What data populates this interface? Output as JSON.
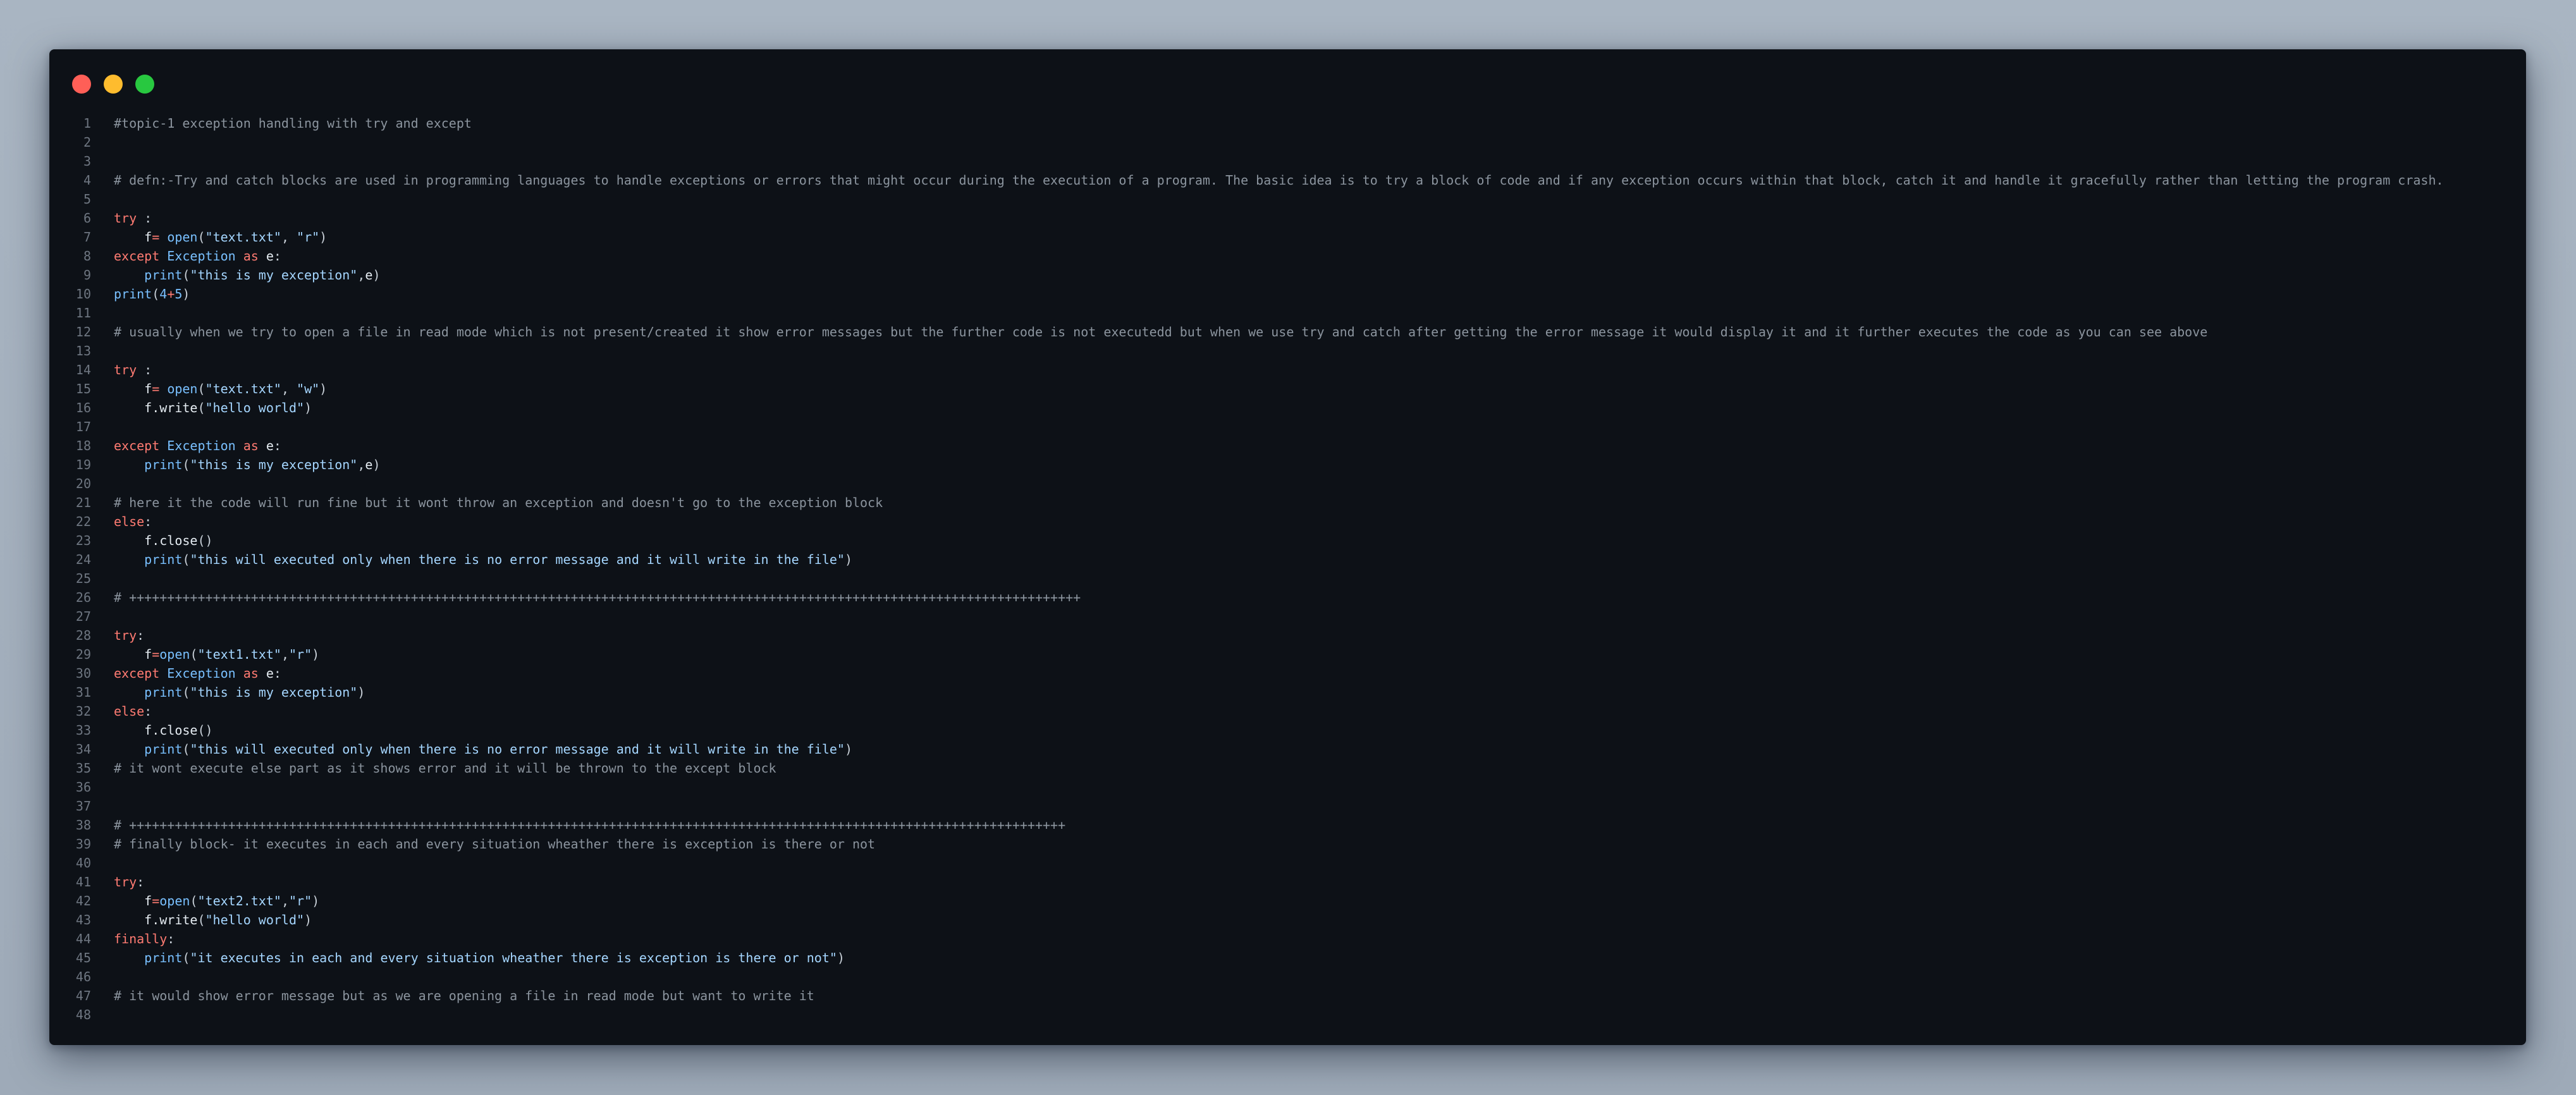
{
  "window": {
    "controls": [
      "close",
      "minimize",
      "maximize"
    ]
  },
  "colors": {
    "background": "#0d1117",
    "line_number": "#6e7681",
    "comment": "#8b949e",
    "keyword": "#ff7b72",
    "function": "#79c0ff",
    "string": "#a5d6ff",
    "text": "#c9d1d9"
  },
  "lines": [
    {
      "n": "1",
      "tokens": [
        [
          "comment",
          "#topic-1 exception handling with try and except"
        ]
      ]
    },
    {
      "n": "2",
      "tokens": []
    },
    {
      "n": "3",
      "tokens": []
    },
    {
      "n": "4",
      "tokens": [
        [
          "comment",
          "# defn:-Try and catch blocks are used in programming languages to handle exceptions or errors that might occur during the execution of a program. The basic idea is to try a block of code and if any exception occurs within that block, catch it and handle it gracefully rather than letting the program crash."
        ]
      ]
    },
    {
      "n": "5",
      "tokens": []
    },
    {
      "n": "6",
      "tokens": [
        [
          "keyword",
          "try"
        ],
        [
          "plain",
          " :"
        ]
      ]
    },
    {
      "n": "7",
      "tokens": [
        [
          "plain",
          "    "
        ],
        [
          "ident",
          "f"
        ],
        [
          "op",
          "="
        ],
        [
          "plain",
          " "
        ],
        [
          "func",
          "open"
        ],
        [
          "punct",
          "("
        ],
        [
          "string",
          "\"text.txt\""
        ],
        [
          "punct",
          ", "
        ],
        [
          "string",
          "\"r\""
        ],
        [
          "punct",
          ")"
        ]
      ]
    },
    {
      "n": "8",
      "tokens": [
        [
          "keyword",
          "except"
        ],
        [
          "plain",
          " "
        ],
        [
          "class",
          "Exception"
        ],
        [
          "plain",
          " "
        ],
        [
          "keyword",
          "as"
        ],
        [
          "plain",
          " "
        ],
        [
          "ident",
          "e"
        ],
        [
          "punct",
          ":"
        ]
      ]
    },
    {
      "n": "9",
      "tokens": [
        [
          "plain",
          "    "
        ],
        [
          "func",
          "print"
        ],
        [
          "punct",
          "("
        ],
        [
          "string",
          "\"this is my exception\""
        ],
        [
          "punct",
          ","
        ],
        [
          "ident",
          "e"
        ],
        [
          "punct",
          ")"
        ]
      ]
    },
    {
      "n": "10",
      "tokens": [
        [
          "func",
          "print"
        ],
        [
          "punct",
          "("
        ],
        [
          "number",
          "4"
        ],
        [
          "op",
          "+"
        ],
        [
          "number",
          "5"
        ],
        [
          "punct",
          ")"
        ]
      ]
    },
    {
      "n": "11",
      "tokens": []
    },
    {
      "n": "12",
      "tokens": [
        [
          "comment",
          "# usually when we try to open a file in read mode which is not present/created it show error messages but the further code is not executedd but when we use try and catch after getting the error message it would display it and it further executes the code as you can see above"
        ]
      ]
    },
    {
      "n": "13",
      "tokens": []
    },
    {
      "n": "14",
      "tokens": [
        [
          "keyword",
          "try"
        ],
        [
          "plain",
          " :"
        ]
      ]
    },
    {
      "n": "15",
      "tokens": [
        [
          "plain",
          "    "
        ],
        [
          "ident",
          "f"
        ],
        [
          "op",
          "="
        ],
        [
          "plain",
          " "
        ],
        [
          "func",
          "open"
        ],
        [
          "punct",
          "("
        ],
        [
          "string",
          "\"text.txt\""
        ],
        [
          "punct",
          ", "
        ],
        [
          "string",
          "\"w\""
        ],
        [
          "punct",
          ")"
        ]
      ]
    },
    {
      "n": "16",
      "tokens": [
        [
          "plain",
          "    "
        ],
        [
          "ident",
          "f.write"
        ],
        [
          "punct",
          "("
        ],
        [
          "string",
          "\"hello world\""
        ],
        [
          "punct",
          ")"
        ]
      ]
    },
    {
      "n": "17",
      "tokens": []
    },
    {
      "n": "18",
      "tokens": [
        [
          "keyword",
          "except"
        ],
        [
          "plain",
          " "
        ],
        [
          "class",
          "Exception"
        ],
        [
          "plain",
          " "
        ],
        [
          "keyword",
          "as"
        ],
        [
          "plain",
          " "
        ],
        [
          "ident",
          "e"
        ],
        [
          "punct",
          ":"
        ]
      ]
    },
    {
      "n": "19",
      "tokens": [
        [
          "plain",
          "    "
        ],
        [
          "func",
          "print"
        ],
        [
          "punct",
          "("
        ],
        [
          "string",
          "\"this is my exception\""
        ],
        [
          "punct",
          ","
        ],
        [
          "ident",
          "e"
        ],
        [
          "punct",
          ")"
        ]
      ]
    },
    {
      "n": "20",
      "tokens": []
    },
    {
      "n": "21",
      "tokens": [
        [
          "comment",
          "# here it the code will run fine but it wont throw an exception and doesn't go to the exception block"
        ]
      ]
    },
    {
      "n": "22",
      "tokens": [
        [
          "keyword",
          "else"
        ],
        [
          "punct",
          ":"
        ]
      ]
    },
    {
      "n": "23",
      "tokens": [
        [
          "plain",
          "    "
        ],
        [
          "ident",
          "f.close"
        ],
        [
          "punct",
          "()"
        ]
      ]
    },
    {
      "n": "24",
      "tokens": [
        [
          "plain",
          "    "
        ],
        [
          "func",
          "print"
        ],
        [
          "punct",
          "("
        ],
        [
          "string",
          "\"this will executed only when there is no error message and it will write in the file\""
        ],
        [
          "punct",
          ")"
        ]
      ]
    },
    {
      "n": "25",
      "tokens": []
    },
    {
      "n": "26",
      "tokens": [
        [
          "comment",
          "# +++++++++++++++++++++++++++++++++++++++++++++++++++++++++++++++++++++++++++++++++++++++++++++++++++++++++++++++++++++++++++++"
        ]
      ]
    },
    {
      "n": "27",
      "tokens": []
    },
    {
      "n": "28",
      "tokens": [
        [
          "keyword",
          "try"
        ],
        [
          "punct",
          ":"
        ]
      ]
    },
    {
      "n": "29",
      "tokens": [
        [
          "plain",
          "    "
        ],
        [
          "ident",
          "f"
        ],
        [
          "op",
          "="
        ],
        [
          "func",
          "open"
        ],
        [
          "punct",
          "("
        ],
        [
          "string",
          "\"text1.txt\""
        ],
        [
          "punct",
          ","
        ],
        [
          "string",
          "\"r\""
        ],
        [
          "punct",
          ")"
        ]
      ]
    },
    {
      "n": "30",
      "tokens": [
        [
          "keyword",
          "except"
        ],
        [
          "plain",
          " "
        ],
        [
          "class",
          "Exception"
        ],
        [
          "plain",
          " "
        ],
        [
          "keyword",
          "as"
        ],
        [
          "plain",
          " "
        ],
        [
          "ident",
          "e"
        ],
        [
          "punct",
          ":"
        ]
      ]
    },
    {
      "n": "31",
      "tokens": [
        [
          "plain",
          "    "
        ],
        [
          "func",
          "print"
        ],
        [
          "punct",
          "("
        ],
        [
          "string",
          "\"this is my exception\""
        ],
        [
          "punct",
          ")"
        ]
      ]
    },
    {
      "n": "32",
      "tokens": [
        [
          "keyword",
          "else"
        ],
        [
          "punct",
          ":"
        ]
      ]
    },
    {
      "n": "33",
      "tokens": [
        [
          "plain",
          "    "
        ],
        [
          "ident",
          "f.close"
        ],
        [
          "punct",
          "()"
        ]
      ]
    },
    {
      "n": "34",
      "tokens": [
        [
          "plain",
          "    "
        ],
        [
          "func",
          "print"
        ],
        [
          "punct",
          "("
        ],
        [
          "string",
          "\"this will executed only when there is no error message and it will write in the file\""
        ],
        [
          "punct",
          ")"
        ]
      ]
    },
    {
      "n": "35",
      "tokens": [
        [
          "comment",
          "# it wont execute else part as it shows error and it will be thrown to the except block"
        ]
      ]
    },
    {
      "n": "36",
      "tokens": []
    },
    {
      "n": "37",
      "tokens": []
    },
    {
      "n": "38",
      "tokens": [
        [
          "comment",
          "# +++++++++++++++++++++++++++++++++++++++++++++++++++++++++++++++++++++++++++++++++++++++++++++++++++++++++++++++++++++++++++"
        ]
      ]
    },
    {
      "n": "39",
      "tokens": [
        [
          "comment",
          "# finally block- it executes in each and every situation wheather there is exception is there or not"
        ]
      ]
    },
    {
      "n": "40",
      "tokens": []
    },
    {
      "n": "41",
      "tokens": [
        [
          "keyword",
          "try"
        ],
        [
          "punct",
          ":"
        ]
      ]
    },
    {
      "n": "42",
      "tokens": [
        [
          "plain",
          "    "
        ],
        [
          "ident",
          "f"
        ],
        [
          "op",
          "="
        ],
        [
          "func",
          "open"
        ],
        [
          "punct",
          "("
        ],
        [
          "string",
          "\"text2.txt\""
        ],
        [
          "punct",
          ","
        ],
        [
          "string",
          "\"r\""
        ],
        [
          "punct",
          ")"
        ]
      ]
    },
    {
      "n": "43",
      "tokens": [
        [
          "plain",
          "    "
        ],
        [
          "ident",
          "f.write"
        ],
        [
          "punct",
          "("
        ],
        [
          "string",
          "\"hello world\""
        ],
        [
          "punct",
          ")"
        ]
      ]
    },
    {
      "n": "44",
      "tokens": [
        [
          "keyword",
          "finally"
        ],
        [
          "punct",
          ":"
        ]
      ]
    },
    {
      "n": "45",
      "tokens": [
        [
          "plain",
          "    "
        ],
        [
          "func",
          "print"
        ],
        [
          "punct",
          "("
        ],
        [
          "string",
          "\"it executes in each and every situation wheather there is exception is there or not\""
        ],
        [
          "punct",
          ")"
        ]
      ]
    },
    {
      "n": "46",
      "tokens": []
    },
    {
      "n": "47",
      "tokens": [
        [
          "comment",
          "# it would show error message but as we are opening a file in read mode but want to write it"
        ]
      ]
    },
    {
      "n": "48",
      "tokens": []
    }
  ]
}
